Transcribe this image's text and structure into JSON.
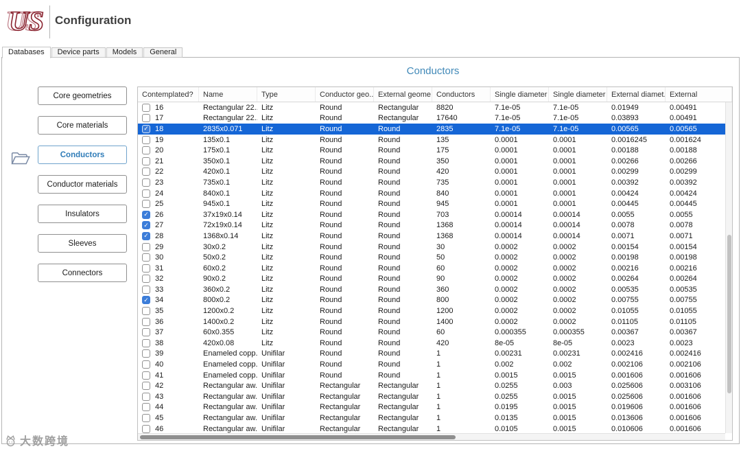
{
  "header": {
    "logo_text": "US",
    "title": "Configuration"
  },
  "tabs": [
    {
      "label": "Databases",
      "active": true
    },
    {
      "label": "Device parts",
      "active": false
    },
    {
      "label": "Models",
      "active": false
    },
    {
      "label": "General",
      "active": false
    }
  ],
  "page_title": "Conductors",
  "sidebar": {
    "folder_icon": "open-folder-icon",
    "buttons": [
      {
        "label": "Core geometries",
        "active": false
      },
      {
        "label": "Core materials",
        "active": false
      },
      {
        "label": "Conductors",
        "active": true
      },
      {
        "label": "Conductor materials",
        "active": false
      },
      {
        "label": "Insulators",
        "active": false
      },
      {
        "label": "Sleeves",
        "active": false
      },
      {
        "label": "Connectors",
        "active": false
      }
    ]
  },
  "table": {
    "columns": [
      "Contemplated?",
      "Name",
      "Type",
      "Conductor geo...",
      "External geome...",
      "Conductors",
      "Single diameter ...",
      "Single diameter ...",
      "External diamet...",
      "External"
    ],
    "rows": [
      {
        "checked": false,
        "selected": false,
        "cells": [
          "16",
          "Rectangular 22...",
          "Litz",
          "Round",
          "Rectangular",
          "8820",
          "7.1e-05",
          "7.1e-05",
          "0.01949",
          "0.00491"
        ]
      },
      {
        "checked": false,
        "selected": false,
        "cells": [
          "17",
          "Rectangular 22...",
          "Litz",
          "Round",
          "Rectangular",
          "17640",
          "7.1e-05",
          "7.1e-05",
          "0.03893",
          "0.00491"
        ]
      },
      {
        "checked": true,
        "selected": true,
        "cells": [
          "18",
          "2835x0.071",
          "Litz",
          "Round",
          "Round",
          "2835",
          "7.1e-05",
          "7.1e-05",
          "0.00565",
          "0.00565"
        ]
      },
      {
        "checked": false,
        "selected": false,
        "cells": [
          "19",
          "135x0.1",
          "Litz",
          "Round",
          "Round",
          "135",
          "0.0001",
          "0.0001",
          "0.0016245",
          "0.001624"
        ]
      },
      {
        "checked": false,
        "selected": false,
        "cells": [
          "20",
          "175x0.1",
          "Litz",
          "Round",
          "Round",
          "175",
          "0.0001",
          "0.0001",
          "0.00188",
          "0.00188"
        ]
      },
      {
        "checked": false,
        "selected": false,
        "cells": [
          "21",
          "350x0.1",
          "Litz",
          "Round",
          "Round",
          "350",
          "0.0001",
          "0.0001",
          "0.00266",
          "0.00266"
        ]
      },
      {
        "checked": false,
        "selected": false,
        "cells": [
          "22",
          "420x0.1",
          "Litz",
          "Round",
          "Round",
          "420",
          "0.0001",
          "0.0001",
          "0.00299",
          "0.00299"
        ]
      },
      {
        "checked": false,
        "selected": false,
        "cells": [
          "23",
          "735x0.1",
          "Litz",
          "Round",
          "Round",
          "735",
          "0.0001",
          "0.0001",
          "0.00392",
          "0.00392"
        ]
      },
      {
        "checked": false,
        "selected": false,
        "cells": [
          "24",
          "840x0.1",
          "Litz",
          "Round",
          "Round",
          "840",
          "0.0001",
          "0.0001",
          "0.00424",
          "0.00424"
        ]
      },
      {
        "checked": false,
        "selected": false,
        "cells": [
          "25",
          "945x0.1",
          "Litz",
          "Round",
          "Round",
          "945",
          "0.0001",
          "0.0001",
          "0.00445",
          "0.00445"
        ]
      },
      {
        "checked": true,
        "selected": false,
        "cells": [
          "26",
          "37x19x0.14",
          "Litz",
          "Round",
          "Round",
          "703",
          "0.00014",
          "0.00014",
          "0.0055",
          "0.0055"
        ]
      },
      {
        "checked": true,
        "selected": false,
        "cells": [
          "27",
          "72x19x0.14",
          "Litz",
          "Round",
          "Round",
          "1368",
          "0.00014",
          "0.00014",
          "0.0078",
          "0.0078"
        ]
      },
      {
        "checked": true,
        "selected": false,
        "cells": [
          "28",
          "1368x0.14",
          "Litz",
          "Round",
          "Round",
          "1368",
          "0.00014",
          "0.00014",
          "0.0071",
          "0.0071"
        ]
      },
      {
        "checked": false,
        "selected": false,
        "cells": [
          "29",
          "30x0.2",
          "Litz",
          "Round",
          "Round",
          "30",
          "0.0002",
          "0.0002",
          "0.00154",
          "0.00154"
        ]
      },
      {
        "checked": false,
        "selected": false,
        "cells": [
          "30",
          "50x0.2",
          "Litz",
          "Round",
          "Round",
          "50",
          "0.0002",
          "0.0002",
          "0.00198",
          "0.00198"
        ]
      },
      {
        "checked": false,
        "selected": false,
        "cells": [
          "31",
          "60x0.2",
          "Litz",
          "Round",
          "Round",
          "60",
          "0.0002",
          "0.0002",
          "0.00216",
          "0.00216"
        ]
      },
      {
        "checked": false,
        "selected": false,
        "cells": [
          "32",
          "90x0.2",
          "Litz",
          "Round",
          "Round",
          "90",
          "0.0002",
          "0.0002",
          "0.00264",
          "0.00264"
        ]
      },
      {
        "checked": false,
        "selected": false,
        "cells": [
          "33",
          "360x0.2",
          "Litz",
          "Round",
          "Round",
          "360",
          "0.0002",
          "0.0002",
          "0.00535",
          "0.00535"
        ]
      },
      {
        "checked": true,
        "selected": false,
        "cells": [
          "34",
          "800x0.2",
          "Litz",
          "Round",
          "Round",
          "800",
          "0.0002",
          "0.0002",
          "0.00755",
          "0.00755"
        ]
      },
      {
        "checked": false,
        "selected": false,
        "cells": [
          "35",
          "1200x0.2",
          "Litz",
          "Round",
          "Round",
          "1200",
          "0.0002",
          "0.0002",
          "0.01055",
          "0.01055"
        ]
      },
      {
        "checked": false,
        "selected": false,
        "cells": [
          "36",
          "1400x0.2",
          "Litz",
          "Round",
          "Round",
          "1400",
          "0.0002",
          "0.0002",
          "0.01105",
          "0.01105"
        ]
      },
      {
        "checked": false,
        "selected": false,
        "cells": [
          "37",
          "60x0.355",
          "Litz",
          "Round",
          "Round",
          "60",
          "0.000355",
          "0.000355",
          "0.00367",
          "0.00367"
        ]
      },
      {
        "checked": false,
        "selected": false,
        "cells": [
          "38",
          "420x0.08",
          "Litz",
          "Round",
          "Round",
          "420",
          "8e-05",
          "8e-05",
          "0.0023",
          "0.0023"
        ]
      },
      {
        "checked": false,
        "selected": false,
        "cells": [
          "39",
          "Enameled copp...",
          "Unifilar",
          "Round",
          "Round",
          "1",
          "0.00231",
          "0.00231",
          "0.002416",
          "0.002416"
        ]
      },
      {
        "checked": false,
        "selected": false,
        "cells": [
          "40",
          "Enameled copp...",
          "Unifilar",
          "Round",
          "Round",
          "1",
          "0.002",
          "0.002",
          "0.002106",
          "0.002106"
        ]
      },
      {
        "checked": false,
        "selected": false,
        "cells": [
          "41",
          "Enameled copp...",
          "Unifilar",
          "Round",
          "Round",
          "1",
          "0.0015",
          "0.0015",
          "0.001606",
          "0.001606"
        ]
      },
      {
        "checked": false,
        "selected": false,
        "cells": [
          "42",
          "Rectangular aw...",
          "Unifilar",
          "Rectangular",
          "Rectangular",
          "1",
          "0.0255",
          "0.003",
          "0.025606",
          "0.003106"
        ]
      },
      {
        "checked": false,
        "selected": false,
        "cells": [
          "43",
          "Rectangular aw...",
          "Unifilar",
          "Rectangular",
          "Rectangular",
          "1",
          "0.0255",
          "0.0015",
          "0.025606",
          "0.001606"
        ]
      },
      {
        "checked": false,
        "selected": false,
        "cells": [
          "44",
          "Rectangular aw...",
          "Unifilar",
          "Rectangular",
          "Rectangular",
          "1",
          "0.0195",
          "0.0015",
          "0.019606",
          "0.001606"
        ]
      },
      {
        "checked": false,
        "selected": false,
        "cells": [
          "45",
          "Rectangular aw...",
          "Unifilar",
          "Rectangular",
          "Rectangular",
          "1",
          "0.0135",
          "0.0015",
          "0.013606",
          "0.001606"
        ]
      },
      {
        "checked": false,
        "selected": false,
        "cells": [
          "46",
          "Rectangular aw...",
          "Unifilar",
          "Rectangular",
          "Rectangular",
          "1",
          "0.0105",
          "0.0015",
          "0.010606",
          "0.001606"
        ]
      }
    ]
  },
  "icons": {
    "check_glyph": "✓"
  },
  "watermark": {
    "text": "大数跨境"
  },
  "colors": {
    "selection_blue": "#1566d6",
    "checkbox_blue": "#3c7dd9",
    "title_blue": "#4189b8",
    "active_button_blue": "#2f7cb8",
    "logo_red": "#8a2430",
    "watermark_gray": "#a0a0a0"
  }
}
